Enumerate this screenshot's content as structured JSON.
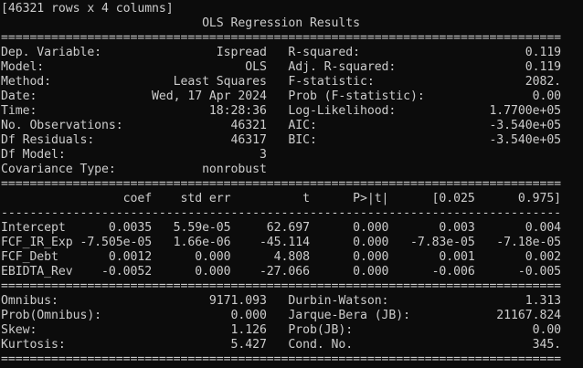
{
  "terminal": {
    "lines": [
      "[46321 rows x 4 columns]",
      "                            OLS Regression Results",
      "==============================================================================",
      "Dep. Variable:                Ispread   R-squared:                       0.119",
      "Model:                            OLS   Adj. R-squared:                  0.119",
      "Method:                 Least Squares   F-statistic:                     2082.",
      "Date:                Wed, 17 Apr 2024   Prob (F-statistic):               0.00",
      "Time:                        18:28:36   Log-Likelihood:             1.7700e+05",
      "No. Observations:               46321   AIC:                        -3.540e+05",
      "Df Residuals:                   46317   BIC:                        -3.540e+05",
      "Df Model:                           3",
      "Covariance Type:            nonrobust",
      "==============================================================================",
      "                 coef    std err          t      P>|t|      [0.025      0.975]",
      "------------------------------------------------------------------------------",
      "Intercept      0.0035   5.59e-05     62.697      0.000       0.003       0.004",
      "FCF_IR_Exp -7.505e-05   1.66e-06    -45.114      0.000   -7.83e-05   -7.18e-05",
      "FCF_Debt       0.0012      0.000      4.808      0.000       0.001       0.002",
      "EBIDTA_Rev    -0.0052      0.000    -27.066      0.000      -0.006      -0.005",
      "==============================================================================",
      "Omnibus:                     9171.093   Durbin-Watson:                   1.313",
      "Prob(Omnibus):                  0.000   Jarque-Bera (JB):            21167.824",
      "Skew:                           1.126   Prob(JB):                         0.00",
      "Kurtosis:                       5.427   Cond. No.                         345.",
      "=============================================================================="
    ]
  }
}
